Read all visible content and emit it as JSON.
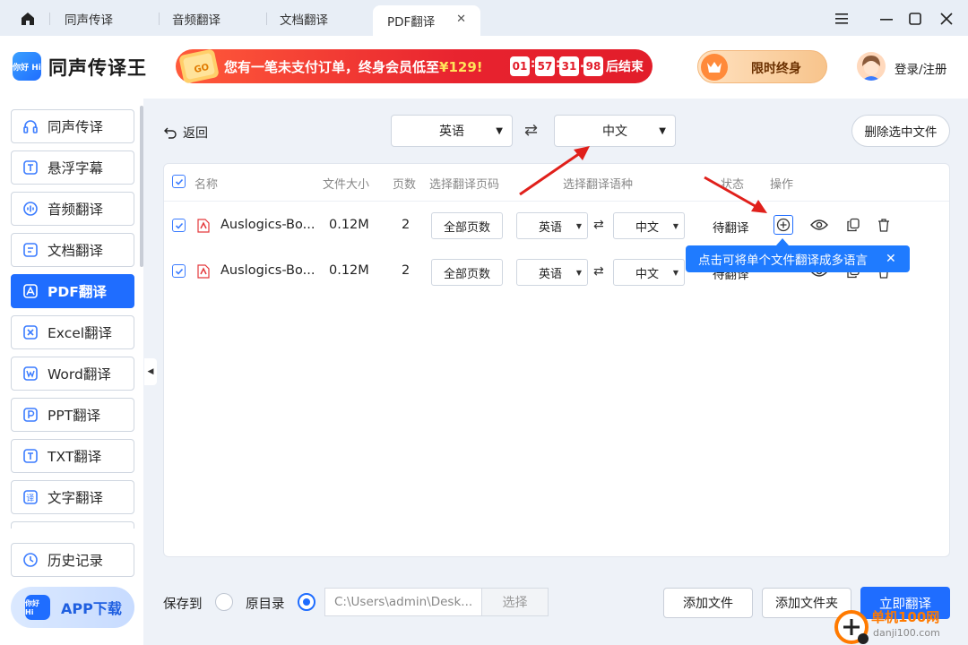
{
  "tabs": [
    {
      "label": "同声传译"
    },
    {
      "label": "音频翻译"
    },
    {
      "label": "文档翻译"
    },
    {
      "label": "PDF翻译",
      "active": true
    }
  ],
  "app": {
    "name": "同声传译王",
    "logo_text": "你好 Hi"
  },
  "promo": {
    "text": "您有一笔未支付订单，终身会员低至",
    "price": "¥129!",
    "countdown": [
      "01",
      "57",
      "31",
      "98"
    ],
    "suffix": "后结束"
  },
  "vip": {
    "label": "限时终身"
  },
  "user": {
    "login": "登录/注册"
  },
  "sidebar": {
    "items": [
      {
        "label": "同声传译",
        "icon": "headphones-icon"
      },
      {
        "label": "悬浮字幕",
        "icon": "subtitle-icon"
      },
      {
        "label": "音频翻译",
        "icon": "audio-icon"
      },
      {
        "label": "文档翻译",
        "icon": "document-icon"
      },
      {
        "label": "PDF翻译",
        "icon": "pdf-icon",
        "active": true
      },
      {
        "label": "Excel翻译",
        "icon": "excel-icon"
      },
      {
        "label": "Word翻译",
        "icon": "word-icon"
      },
      {
        "label": "PPT翻译",
        "icon": "ppt-icon"
      },
      {
        "label": "TXT翻译",
        "icon": "txt-icon"
      },
      {
        "label": "文字翻译",
        "icon": "text-translate-icon"
      }
    ],
    "history": "历史记录",
    "app_download": "APP下载"
  },
  "toolbar": {
    "back": "返回",
    "source_lang": "英语",
    "target_lang": "中文",
    "delete_selected": "删除选中文件"
  },
  "table": {
    "headers": {
      "name": "名称",
      "size": "文件大小",
      "pages": "页数",
      "page_range": "选择翻译页码",
      "lang": "选择翻译语种",
      "status": "状态",
      "ops": "操作"
    },
    "rows": [
      {
        "name": "Auslogics-Bo...",
        "size": "0.12M",
        "pages": "2",
        "page_btn": "全部页数",
        "src": "英语",
        "dst": "中文",
        "status": "待翻译"
      },
      {
        "name": "Auslogics-Bo...",
        "size": "0.12M",
        "pages": "2",
        "page_btn": "全部页数",
        "src": "英语",
        "dst": "中文",
        "status": "待翻译"
      }
    ]
  },
  "tooltip": {
    "text": "点击可将单个文件翻译成多语言",
    "close": "✕"
  },
  "bottom": {
    "save_to": "保存到",
    "original_dir": "原目录",
    "path": "C:\\Users\\admin\\Desk...",
    "choose": "选择",
    "add_file": "添加文件",
    "add_folder": "添加文件夹",
    "translate_now": "立即翻译"
  },
  "watermark": {
    "line1": "单机100网",
    "line2": "danji100.com"
  },
  "colors": {
    "accent": "#1f6dff",
    "promo_red": "#e21d2a",
    "arrow_red": "#e0201b"
  }
}
